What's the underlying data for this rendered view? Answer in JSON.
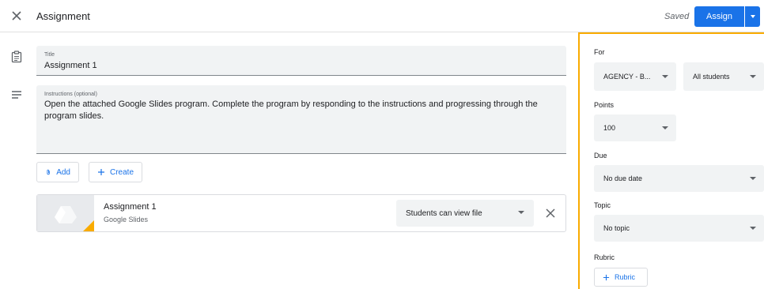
{
  "header": {
    "title": "Assignment",
    "saved_status": "Saved",
    "assign_label": "Assign"
  },
  "form": {
    "title_label": "Title",
    "title_value": "Assignment 1",
    "instructions_label": "Instructions (optional)",
    "instructions_value": "Open the attached Google Slides program. Complete the program by responding to the instructions and progressing through the program slides."
  },
  "actions": {
    "add_label": "Add",
    "create_label": "Create"
  },
  "attachment": {
    "title": "Assignment 1",
    "type": "Google Slides",
    "permission": "Students can view file"
  },
  "panel": {
    "for_label": "For",
    "class_value": "AGENCY - B...",
    "students_value": "All students",
    "points_label": "Points",
    "points_value": "100",
    "due_label": "Due",
    "due_value": "No due date",
    "topic_label": "Topic",
    "topic_value": "No topic",
    "rubric_label": "Rubric",
    "rubric_button": "Rubric"
  },
  "colors": {
    "accent": "#1a73e8",
    "panel_border": "#f9ab00",
    "field_bg": "#f1f3f4"
  }
}
